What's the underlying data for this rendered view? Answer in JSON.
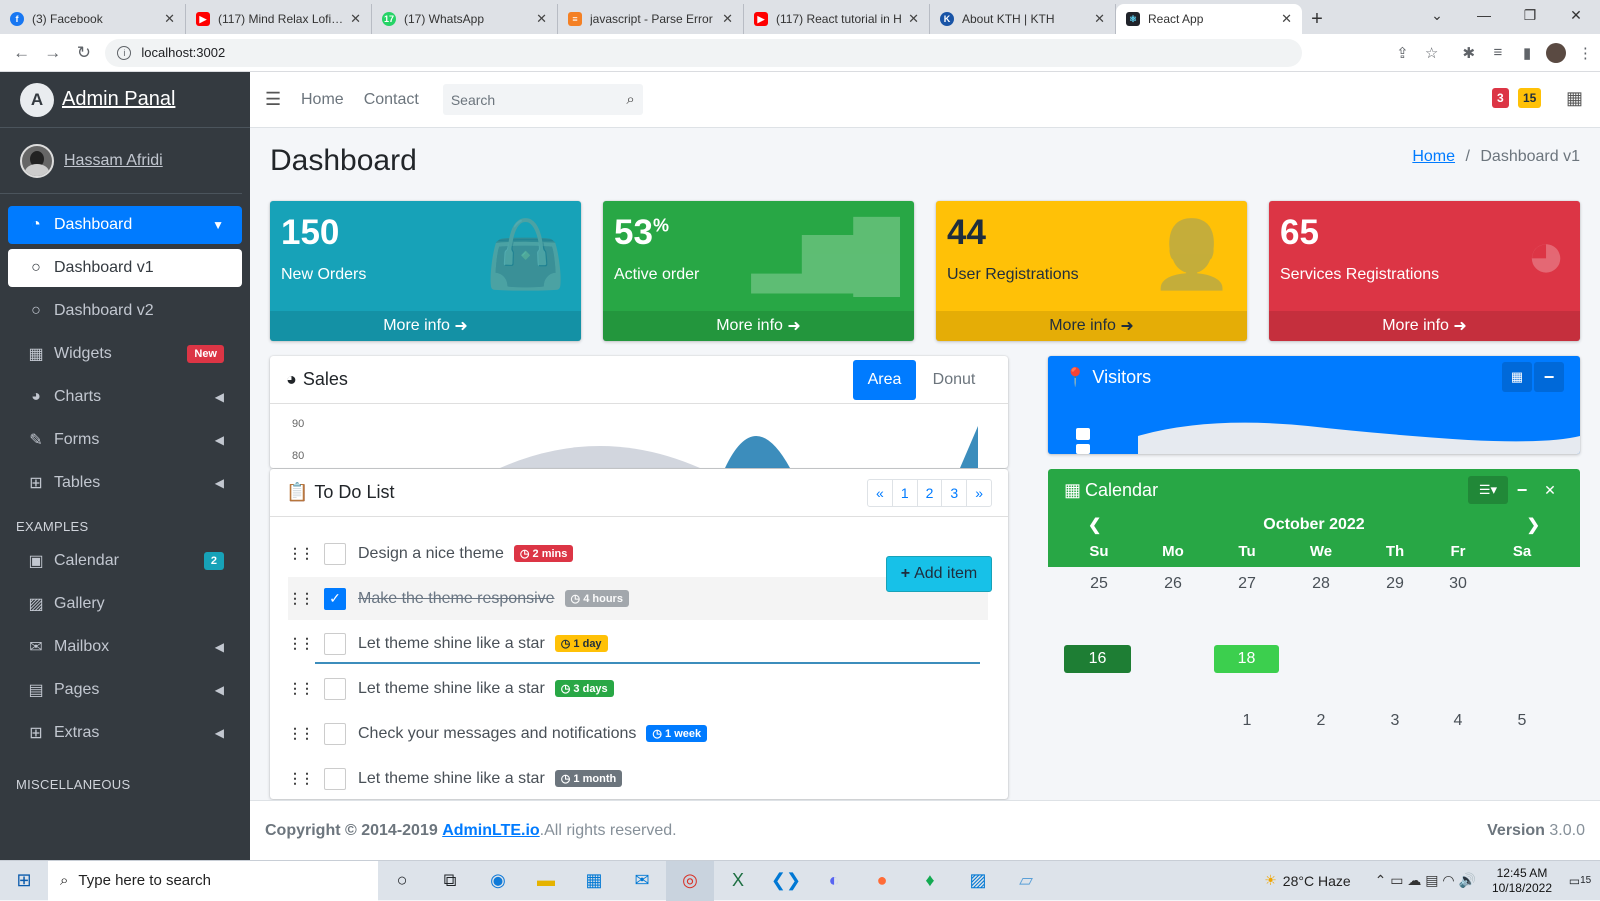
{
  "browser": {
    "tabs": [
      {
        "title": "(3) Facebook",
        "color": "#1877f2",
        "glyph": "f"
      },
      {
        "title": "(117) Mind Relax Lofi m",
        "color": "#ff0000",
        "glyph": "▶"
      },
      {
        "title": "(17) WhatsApp",
        "color": "#25d366",
        "glyph": "17"
      },
      {
        "title": "javascript - Parse Error",
        "color": "#f48024",
        "glyph": "≡"
      },
      {
        "title": "(117) React tutorial in H",
        "color": "#ff0000",
        "glyph": "▶"
      },
      {
        "title": "About KTH | KTH",
        "color": "#1954a6",
        "glyph": "K"
      },
      {
        "title": "React App",
        "color": "#20232a",
        "glyph": "⚛"
      }
    ],
    "url": "localhost:3002"
  },
  "sidebar": {
    "brand": "Admin Panal",
    "brand_logo": "A",
    "user": "Hassam Afridi",
    "items": [
      {
        "label": "Dashboard",
        "icon": "dashboard-icon"
      },
      {
        "label": "Dashboard v1",
        "icon": "circle-icon"
      },
      {
        "label": "Dashboard v2",
        "icon": "circle-icon"
      },
      {
        "label": "Widgets",
        "icon": "widgets-icon",
        "badge": "New"
      },
      {
        "label": "Charts",
        "icon": "pie-chart-icon"
      },
      {
        "label": "Forms",
        "icon": "edit-icon"
      },
      {
        "label": "Tables",
        "icon": "table-icon"
      }
    ],
    "examples_header": "EXAMPLES",
    "examples": [
      {
        "label": "Calendar",
        "icon": "calendar-icon",
        "badge": "2"
      },
      {
        "label": "Gallery",
        "icon": "image-icon"
      },
      {
        "label": "Mailbox",
        "icon": "envelope-icon"
      },
      {
        "label": "Pages",
        "icon": "book-icon"
      },
      {
        "label": "Extras",
        "icon": "plus-square-icon"
      }
    ],
    "misc_header": "MISCELLANEOUS"
  },
  "topnav": {
    "home": "Home",
    "contact": "Contact",
    "search_placeholder": "Search",
    "badge_red": "3",
    "badge_yellow": "15"
  },
  "page": {
    "title": "Dashboard",
    "breadcrumb_home": "Home",
    "breadcrumb_sep": "/",
    "breadcrumb_current": "Dashboard v1"
  },
  "stats": [
    {
      "value": "150",
      "sup": "",
      "label": "New Orders",
      "footer": "More info",
      "color": "#17a2b8",
      "icon": "shopping-bag-icon"
    },
    {
      "value": "53",
      "sup": "%",
      "label": "Active order",
      "footer": "More info",
      "color": "#28a745",
      "icon": "bar-chart-icon"
    },
    {
      "value": "44",
      "sup": "",
      "label": "User Registrations",
      "footer": "More info",
      "color": "#ffc107",
      "icon": "user-plus-icon"
    },
    {
      "value": "65",
      "sup": "",
      "label": "Services Registrations",
      "footer": "More info",
      "color": "#dc3545",
      "icon": "pie-chart-icon"
    }
  ],
  "sales": {
    "title": "Sales",
    "tab_area": "Area",
    "tab_donut": "Donut",
    "y_labels": [
      "90",
      "80"
    ]
  },
  "todo": {
    "title": "To Do List",
    "pagination": [
      "«",
      "1",
      "2",
      "3",
      "»"
    ],
    "add_item": "Add item",
    "items": [
      {
        "text": "Design a nice theme",
        "badge": "2 mins",
        "badge_color": "#dc3545",
        "done": false
      },
      {
        "text": "Make the theme responsive",
        "badge": "4 hours",
        "badge_color": "#6c757d",
        "done": true
      },
      {
        "text": "Let theme shine like a star",
        "badge": "1 day",
        "badge_color": "#ffc107",
        "done": false
      },
      {
        "text": "Let theme shine like a star",
        "badge": "3 days",
        "badge_color": "#28a745",
        "done": false
      },
      {
        "text": "Check your messages and notifications",
        "badge": "1 week",
        "badge_color": "#007bff",
        "done": false
      },
      {
        "text": "Let theme shine like a star",
        "badge": "1 month",
        "badge_color": "#6c757d",
        "done": false
      }
    ]
  },
  "visitors": {
    "title": "Visitors"
  },
  "calendar": {
    "title": "Calendar",
    "month": "October 2022",
    "weekdays": [
      "Su",
      "Mo",
      "Tu",
      "We",
      "Th",
      "Fr",
      "Sa"
    ],
    "row1": [
      "25",
      "26",
      "27",
      "28",
      "29",
      "30"
    ],
    "highlight_a": "16",
    "highlight_b": "18",
    "last_row": [
      "1",
      "2",
      "3",
      "4",
      "5"
    ]
  },
  "footer": {
    "copyright": "Copyright © 2014-2019",
    "link": "AdminLTE.io",
    "rights": ".All rights reserved.",
    "version_label": "Version",
    "version": "3.0.0"
  },
  "taskbar": {
    "search_placeholder": "Type here to search",
    "weather": "28°C  Haze",
    "time": "12:45 AM",
    "date": "10/18/2022",
    "notif_count": "15"
  }
}
